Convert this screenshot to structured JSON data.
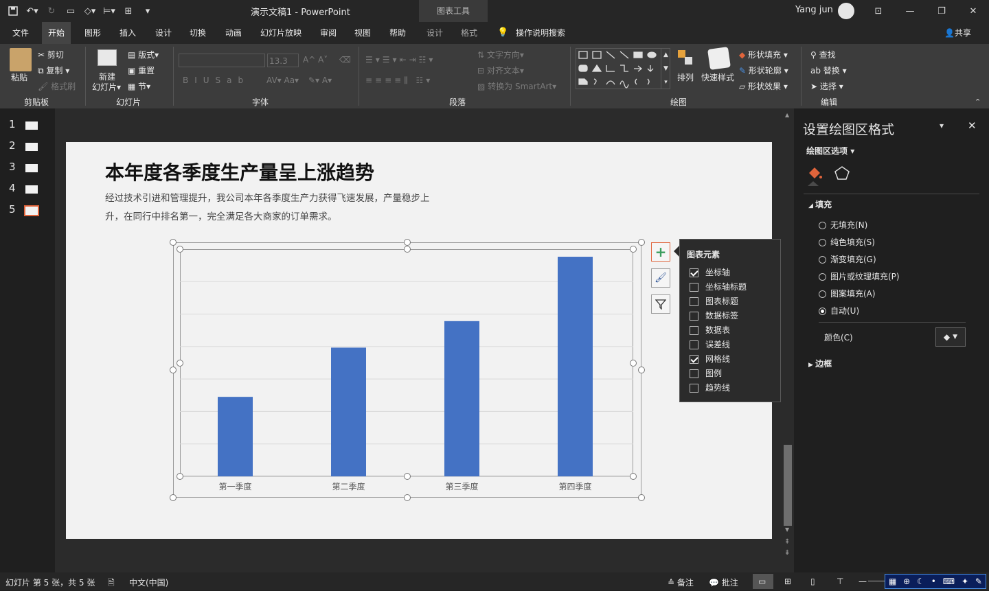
{
  "window": {
    "doc_title": "演示文稿1  -  PowerPoint",
    "context_tools": "图表工具",
    "user": "Yang jun",
    "share_label": "共享"
  },
  "tabs": [
    "文件",
    "开始",
    "图形",
    "插入",
    "设计",
    "切换",
    "动画",
    "幻灯片放映",
    "审阅",
    "视图",
    "帮助"
  ],
  "ctx_tabs": [
    "设计",
    "格式"
  ],
  "tell_me": "操作说明搜索",
  "ribbon": {
    "clipboard": {
      "paste": "粘贴",
      "cut": "剪切",
      "copy": "复制",
      "format_painter": "格式刷",
      "label": "剪贴板"
    },
    "slides": {
      "new_slide": "新建",
      "new_slide2": "幻灯片",
      "layout": "版式",
      "reset": "重置",
      "section": "节",
      "label": "幻灯片"
    },
    "font": {
      "size": "13.3",
      "label": "字体"
    },
    "paragraph": {
      "text_direction": "文字方向",
      "align_text": "对齐文本",
      "smartart": "转换为 SmartArt",
      "label": "段落"
    },
    "drawing": {
      "arrange": "排列",
      "quick_styles": "快速样式",
      "shape_fill": "形状填充",
      "shape_outline": "形状轮廓",
      "shape_effects": "形状效果",
      "label": "绘图"
    },
    "editing": {
      "find": "查找",
      "replace": "替换",
      "select": "选择",
      "label": "编辑"
    }
  },
  "thumbnails": [
    "1",
    "2",
    "3",
    "4",
    "5"
  ],
  "slide": {
    "title": "本年度各季度生产量呈上涨趋势",
    "body_line1": "经过技术引进和管理提升，我公司本年各季度生产力获得飞速发展，产量稳步上",
    "body_line2": "升，在同行中排名第一，完全满足各大商家的订单需求。"
  },
  "chart_data": {
    "type": "bar",
    "categories": [
      "第一季度",
      "第二季度",
      "第三季度",
      "第四季度"
    ],
    "values": [
      2.1,
      3.4,
      4.1,
      5.8
    ],
    "ylim": [
      0,
      6
    ],
    "grid": true,
    "color": "#4472c4"
  },
  "chart_elements": {
    "title": "图表元素",
    "items": [
      {
        "label": "坐标轴",
        "checked": true
      },
      {
        "label": "坐标轴标题",
        "checked": false
      },
      {
        "label": "图表标题",
        "checked": false
      },
      {
        "label": "数据标签",
        "checked": false
      },
      {
        "label": "数据表",
        "checked": false
      },
      {
        "label": "误差线",
        "checked": false
      },
      {
        "label": "网格线",
        "checked": true
      },
      {
        "label": "图例",
        "checked": false
      },
      {
        "label": "趋势线",
        "checked": false
      }
    ]
  },
  "format_pane": {
    "title": "设置绘图区格式",
    "options": "绘图区选项",
    "fill_header": "填充",
    "fill_options": [
      {
        "label": "无填充(N)",
        "selected": false
      },
      {
        "label": "纯色填充(S)",
        "selected": false
      },
      {
        "label": "渐变填充(G)",
        "selected": false
      },
      {
        "label": "图片或纹理填充(P)",
        "selected": false
      },
      {
        "label": "图案填充(A)",
        "selected": false
      },
      {
        "label": "自动(U)",
        "selected": true
      }
    ],
    "color_label": "颜色(C)",
    "border_header": "边框"
  },
  "status": {
    "slide_info": "幻灯片 第 5 张，共 5 张",
    "language": "中文(中国)",
    "notes": "备注",
    "comments": "批注"
  }
}
